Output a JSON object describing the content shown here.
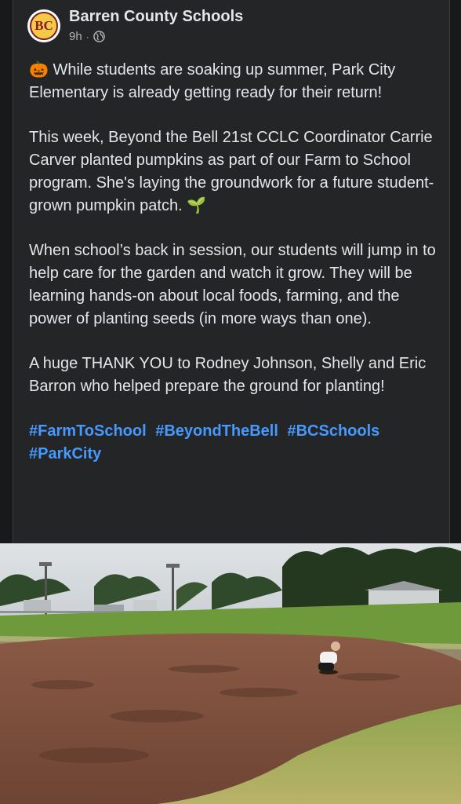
{
  "post": {
    "author": "Barren County Schools",
    "avatar_text": "BC",
    "time": "9h",
    "separator": "·",
    "privacy_icon": "globe-icon",
    "paragraphs": [
      "🎃 While students are soaking up summer, Park City Elementary is already getting ready for their return!",
      "This week, Beyond the Bell 21st CCLC Coordinator Carrie Carver planted pumpkins as part of our Farm to School program. She's laying the groundwork for a future student-grown pumpkin patch. 🌱",
      "When school’s back in session, our students will jump in to help care for the garden and watch it grow. They will be learning hands-on about local foods, farming, and the power of planting seeds (in more ways than one).",
      "A huge THANK YOU to Rodney Johnson, Shelly and Eric Barron who helped prepare the ground for planting!"
    ],
    "hashtags": [
      "#FarmToSchool",
      "#BeyondTheBell",
      "#BCSchools",
      "#ParkCity"
    ]
  },
  "colors": {
    "background": "#18191a",
    "card": "#242526",
    "text": "#e4e6eb",
    "secondary": "#b0b3b8",
    "link": "#4599ff"
  }
}
